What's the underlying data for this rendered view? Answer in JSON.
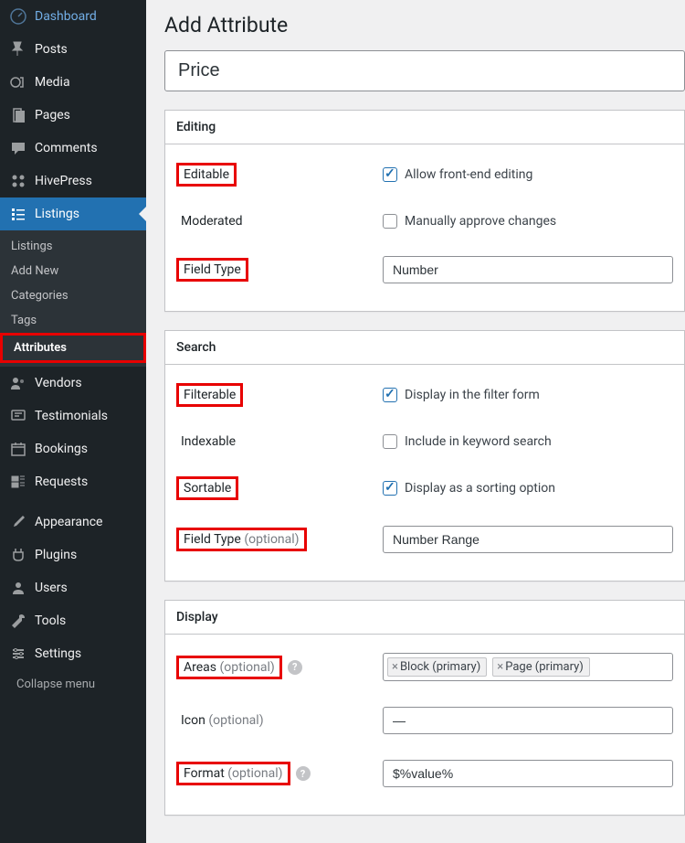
{
  "sidebar": {
    "dashboard": "Dashboard",
    "posts": "Posts",
    "media": "Media",
    "pages": "Pages",
    "comments": "Comments",
    "hivepress": "HivePress",
    "listings": "Listings",
    "submenu": {
      "listings": "Listings",
      "add_new": "Add New",
      "categories": "Categories",
      "tags": "Tags",
      "attributes": "Attributes"
    },
    "vendors": "Vendors",
    "testimonials": "Testimonials",
    "bookings": "Bookings",
    "requests": "Requests",
    "appearance": "Appearance",
    "plugins": "Plugins",
    "users": "Users",
    "tools": "Tools",
    "settings": "Settings",
    "collapse": "Collapse menu"
  },
  "page_title": "Add Attribute",
  "title_value": "Price",
  "boxes": {
    "editing": {
      "header": "Editing",
      "editable_label": "Editable",
      "editable_check": "Allow front-end editing",
      "moderated_label": "Moderated",
      "moderated_check": "Manually approve changes",
      "field_type_label": "Field Type",
      "field_type_value": "Number"
    },
    "search": {
      "header": "Search",
      "filterable_label": "Filterable",
      "filterable_check": "Display in the filter form",
      "indexable_label": "Indexable",
      "indexable_check": "Include in keyword search",
      "sortable_label": "Sortable",
      "sortable_check": "Display as a sorting option",
      "field_type_label": "Field Type",
      "field_type_optional": " (optional)",
      "field_type_value": "Number Range"
    },
    "display": {
      "header": "Display",
      "areas_label": "Areas",
      "areas_optional": " (optional)",
      "area_tokens": [
        "Block (primary)",
        "Page (primary)"
      ],
      "icon_label": "Icon",
      "icon_optional": " (optional)",
      "icon_value": "—",
      "format_label": "Format",
      "format_optional": " (optional)",
      "format_value": "$%value%"
    }
  }
}
